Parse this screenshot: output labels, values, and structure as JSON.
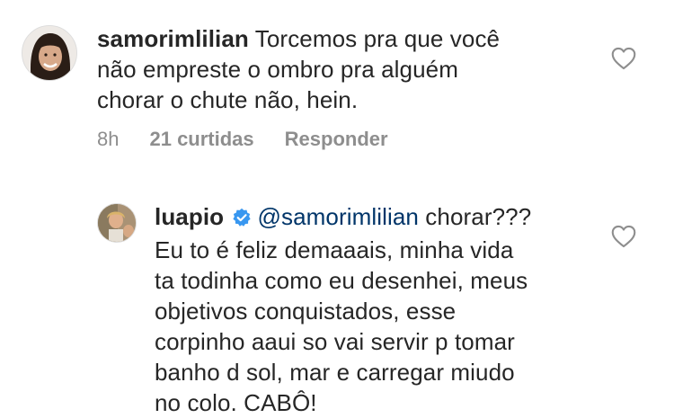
{
  "comment1": {
    "username": "samorimlilian",
    "text_line1": " Torcemos pra que você",
    "text_line2": "não empreste o ombro pra alguém",
    "text_line3": "chorar o chute não, hein.",
    "time": "8h",
    "likes": "21 curtidas",
    "reply_label": "Responder"
  },
  "comment2": {
    "username": "luapio",
    "mention": "@samorimlilian",
    "text_line1_rest": " chorar???",
    "lines": [
      "Eu to é feliz demaaais, minha vida",
      "ta todinha como eu desenhei, meus",
      "objetivos conquistados, esse",
      "corpinho aaui so vai servir p tomar",
      "banho d sol, mar e carregar miudo",
      "no colo. CABÔ!"
    ]
  },
  "icons": {
    "like": "heart-outline-icon",
    "verified": "verified-badge-icon"
  },
  "colors": {
    "text": "#262626",
    "meta": "#8e8e8e",
    "mention": "#003569",
    "verified": "#3897f0"
  }
}
